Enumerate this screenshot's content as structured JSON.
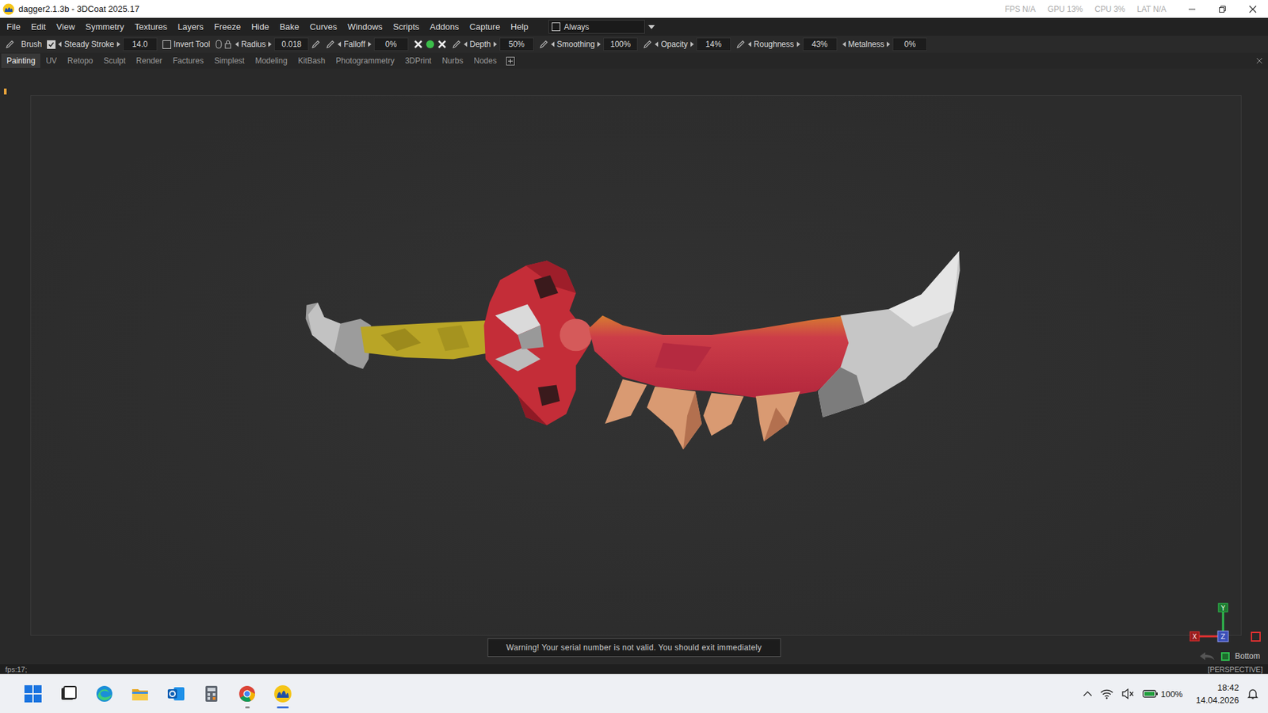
{
  "window": {
    "title": "dagger2.1.3b - 3DCoat 2025.17",
    "stats": [
      "FPS N/A",
      "GPU 13%",
      "CPU 3%",
      "LAT N/A"
    ]
  },
  "menu": [
    "File",
    "Edit",
    "View",
    "Symmetry",
    "Textures",
    "Layers",
    "Freeze",
    "Hide",
    "Bake",
    "Curves",
    "Windows",
    "Scripts",
    "Addons",
    "Capture",
    "Help"
  ],
  "always": {
    "label": "Always",
    "checked": false
  },
  "toolbar": {
    "tool": "Brush",
    "items": [
      {
        "kind": "checkbox",
        "label": "Steady Stroke",
        "checked": true,
        "value": "14.0"
      },
      {
        "kind": "checkbox",
        "label": "Invert Tool",
        "checked": false,
        "value": ""
      },
      {
        "kind": "param",
        "label": "Radius",
        "value": "0.018"
      },
      {
        "kind": "pen-param",
        "label": "Falloff",
        "value": "0%"
      },
      {
        "kind": "switches",
        "label": "",
        "value": ""
      },
      {
        "kind": "pen-param",
        "label": "Depth",
        "value": "50%"
      },
      {
        "kind": "pen-param",
        "label": "Smoothing",
        "value": "100%"
      },
      {
        "kind": "pen-param",
        "label": "Opacity",
        "value": "14%"
      },
      {
        "kind": "pen-param",
        "label": "Roughness",
        "value": "43%"
      },
      {
        "kind": "param",
        "label": "Metalness",
        "value": "0%"
      }
    ]
  },
  "rooms": [
    {
      "label": "Painting",
      "selected": true
    },
    {
      "label": "UV",
      "selected": false
    },
    {
      "label": "Retopo",
      "selected": false
    },
    {
      "label": "Sculpt",
      "selected": false
    },
    {
      "label": "Render",
      "selected": false
    },
    {
      "label": "Factures",
      "selected": false
    },
    {
      "label": "Simplest",
      "selected": false
    },
    {
      "label": "Modeling",
      "selected": false
    },
    {
      "label": "KitBash",
      "selected": false
    },
    {
      "label": "Photogrammetry",
      "selected": false
    },
    {
      "label": "3DPrint",
      "selected": false
    },
    {
      "label": "Nurbs",
      "selected": false
    },
    {
      "label": "Nodes",
      "selected": false
    }
  ],
  "viewport": {
    "warning": "Warning! Your serial number is not valid. You should exit immediately",
    "view_label": "Bottom",
    "axes": [
      "X",
      "Y",
      "Z"
    ]
  },
  "status_bar": {
    "left": "fps:17;",
    "right": "[PERSPECTIVE]"
  },
  "taskbar": {
    "apps": [
      {
        "kind": "start",
        "running": false,
        "active": false
      },
      {
        "kind": "taskview",
        "running": false,
        "active": false
      },
      {
        "kind": "edge",
        "running": false,
        "active": false
      },
      {
        "kind": "explorer",
        "running": false,
        "active": false
      },
      {
        "kind": "outlook",
        "running": false,
        "active": false
      },
      {
        "kind": "calculator",
        "running": false,
        "active": false
      },
      {
        "kind": "chrome",
        "running": true,
        "active": false
      },
      {
        "kind": "coat",
        "running": true,
        "active": true
      }
    ],
    "tray": {
      "battery": "100%",
      "time": "18:42",
      "date": "14.04.2026"
    }
  }
}
